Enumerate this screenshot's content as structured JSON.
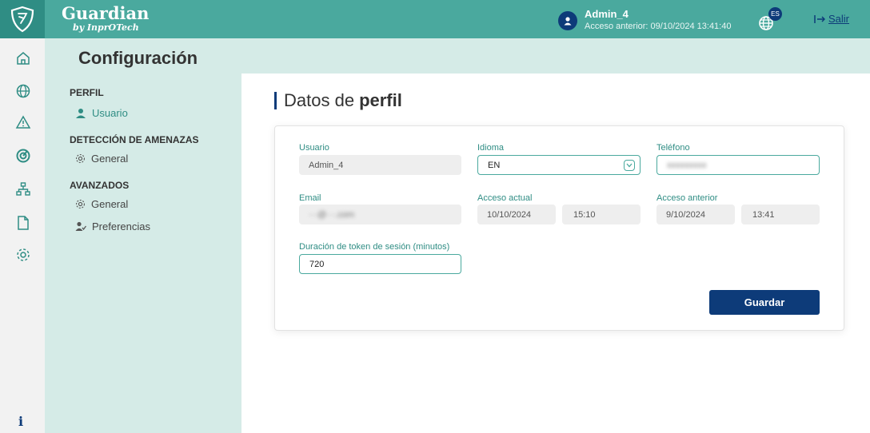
{
  "app": {
    "name": "Guardian",
    "subtitle": "by InprOTech"
  },
  "user": {
    "name": "Admin_4",
    "last_access_text": "Acceso anterior: 09/10/2024 13:41:40"
  },
  "lang_badge": "ES",
  "logout_label": "Salir",
  "page_title": "Configuración",
  "rail_icons": [
    "home-icon",
    "globe-icon",
    "alert-icon",
    "radar-icon",
    "network-icon",
    "file-icon",
    "gear-icon",
    "info-icon"
  ],
  "rail_info_glyph": "i",
  "nav": {
    "perfil": {
      "title": "PERFIL",
      "items": [
        "Usuario"
      ]
    },
    "amenazas": {
      "title": "DETECCIÓN DE AMENAZAS",
      "items": [
        "General"
      ]
    },
    "avanzados": {
      "title": "AVANZADOS",
      "items": [
        "General",
        "Preferencias"
      ]
    }
  },
  "content": {
    "title_part1": "Datos de",
    "title_part2": "perfil"
  },
  "form": {
    "usuario": {
      "label": "Usuario",
      "value": "Admin_4"
    },
    "idioma": {
      "label": "Idioma",
      "value": "EN"
    },
    "telefono": {
      "label": "Teléfono",
      "value": "xxxxxxxxx"
    },
    "email": {
      "label": "Email",
      "value": "···@···.com"
    },
    "acceso_actual": {
      "label": "Acceso actual",
      "date": "10/10/2024",
      "time": "15:10"
    },
    "acceso_anterior": {
      "label": "Acceso anterior",
      "date": "9/10/2024",
      "time": "13:41"
    },
    "token": {
      "label": "Duración de token de sesión (minutos)",
      "value": "720"
    }
  },
  "save_label": "Guardar",
  "colors": {
    "primary": "#0d3b79",
    "teal": "#4aa99e",
    "teal_dark": "#2f8d84",
    "panel": "#d5ebe7"
  }
}
